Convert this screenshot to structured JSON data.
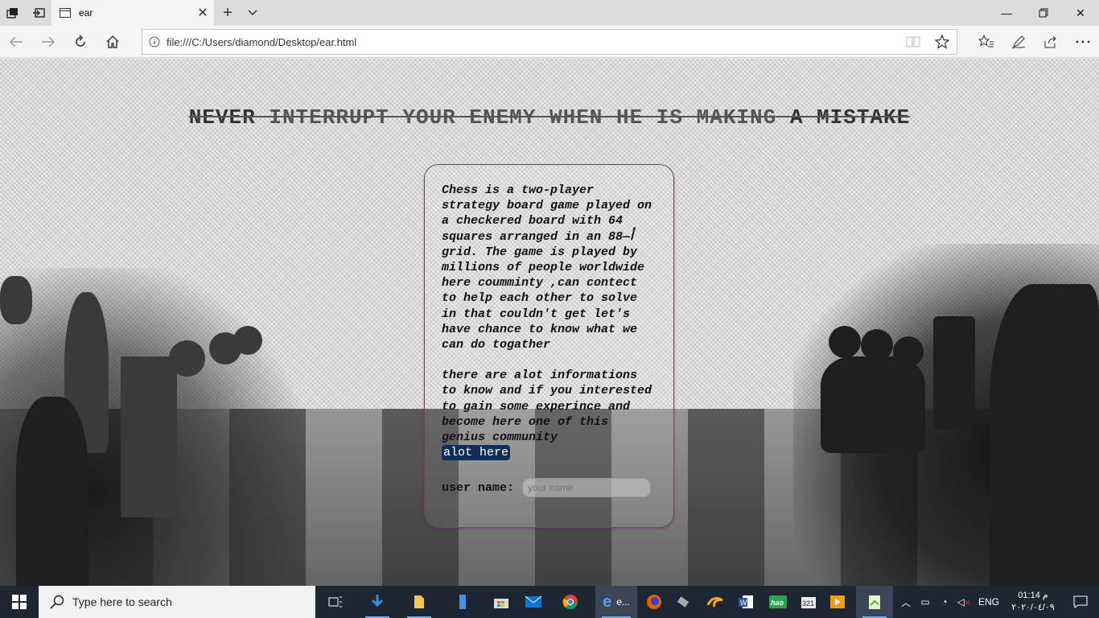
{
  "browser": {
    "tab_title": "ear",
    "address": "file:///C:/Users/diamond/Desktop/ear.html"
  },
  "page": {
    "headline_pre": "NEVER",
    "headline_mid": " INTERRUPT YOUR ENEMY WHEN HE IS MAKING ",
    "headline_post": "A MISTAKE",
    "paragraph1": "Chess is a two-player strategy board game played on a checkered board with 64 squares arranged in an 88—ﺃ grid. The game is played by millions of people worldwide here coumminty ,can contect to help each other to solve in that couldn't get let's have chance to know what we can do togather",
    "paragraph2": "there are alot informations to know and if you interested to gain some experince and become here one of this genius community",
    "link_text": "alot here",
    "user_label": "user name:",
    "user_placeholder": "your name"
  },
  "taskbar": {
    "search_placeholder": "Type here to search",
    "edge_label": "e...",
    "language": "ENG",
    "time": "01:14 م",
    "date": "٢٠٢٠/٠٤/٠٩"
  }
}
